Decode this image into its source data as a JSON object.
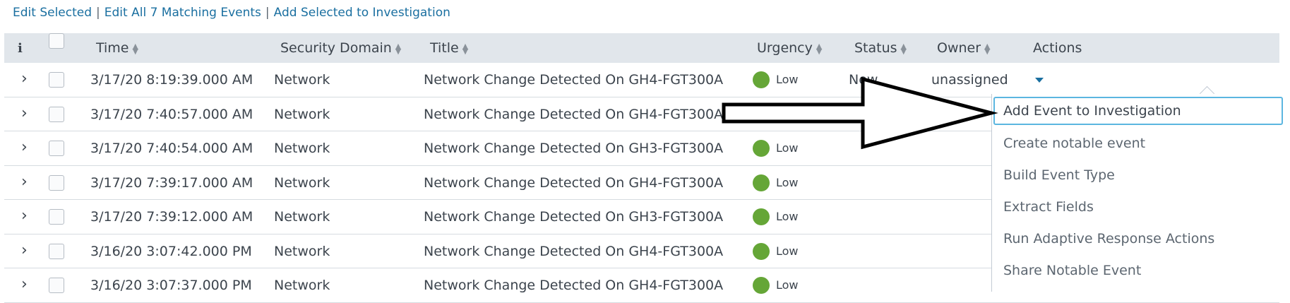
{
  "actions": {
    "edit_selected": "Edit Selected",
    "edit_all": "Edit All 7 Matching Events",
    "add_selected": "Add Selected to Investigation",
    "separator": "|"
  },
  "table": {
    "headers": {
      "info": "i",
      "time": "Time",
      "security_domain": "Security Domain",
      "title": "Title",
      "urgency": "Urgency",
      "status": "Status",
      "owner": "Owner",
      "actions": "Actions"
    },
    "sort_glyph_up": "▲",
    "sort_glyph_down": "▼",
    "rows": [
      {
        "time": "3/17/20 8:19:39.000 AM",
        "domain": "Network",
        "title": "Network Change Detected On GH4-FGT300A",
        "urgency": "Low",
        "status": "New",
        "owner": "unassigned"
      },
      {
        "time": "3/17/20 7:40:57.000 AM",
        "domain": "Network",
        "title": "Network Change Detected On GH4-FGT300A",
        "urgency": "Low",
        "status": "",
        "owner": ""
      },
      {
        "time": "3/17/20 7:40:54.000 AM",
        "domain": "Network",
        "title": "Network Change Detected On GH3-FGT300A",
        "urgency": "Low",
        "status": "",
        "owner": ""
      },
      {
        "time": "3/17/20 7:39:17.000 AM",
        "domain": "Network",
        "title": "Network Change Detected On GH4-FGT300A",
        "urgency": "Low",
        "status": "",
        "owner": ""
      },
      {
        "time": "3/17/20 7:39:12.000 AM",
        "domain": "Network",
        "title": "Network Change Detected On GH3-FGT300A",
        "urgency": "Low",
        "status": "",
        "owner": ""
      },
      {
        "time": "3/16/20 3:07:42.000 PM",
        "domain": "Network",
        "title": "Network Change Detected On GH4-FGT300A",
        "urgency": "Low",
        "status": "",
        "owner": ""
      },
      {
        "time": "3/16/20 3:07:37.000 PM",
        "domain": "Network",
        "title": "Network Change Detected On GH4-FGT300A",
        "urgency": "Low",
        "status": "",
        "owner": ""
      }
    ],
    "expander_glyph": "›"
  },
  "dropdown": {
    "items": [
      "Add Event to Investigation",
      "Create notable event",
      "Build Event Type",
      "Extract Fields",
      "Run Adaptive Response Actions",
      "Share Notable Event"
    ]
  },
  "colors": {
    "urgency_low": "#65a637",
    "link": "#1a6fa0",
    "header_bg": "#e1e6eb",
    "focus_border": "#5bb6e0"
  },
  "icons": {
    "info": "info-icon",
    "expand": "chevron-right-icon",
    "sort": "sort-icon",
    "actions_menu": "caret-down-icon",
    "urgency": "urgency-dot-icon",
    "overlay": "arrow-annotation-icon"
  }
}
